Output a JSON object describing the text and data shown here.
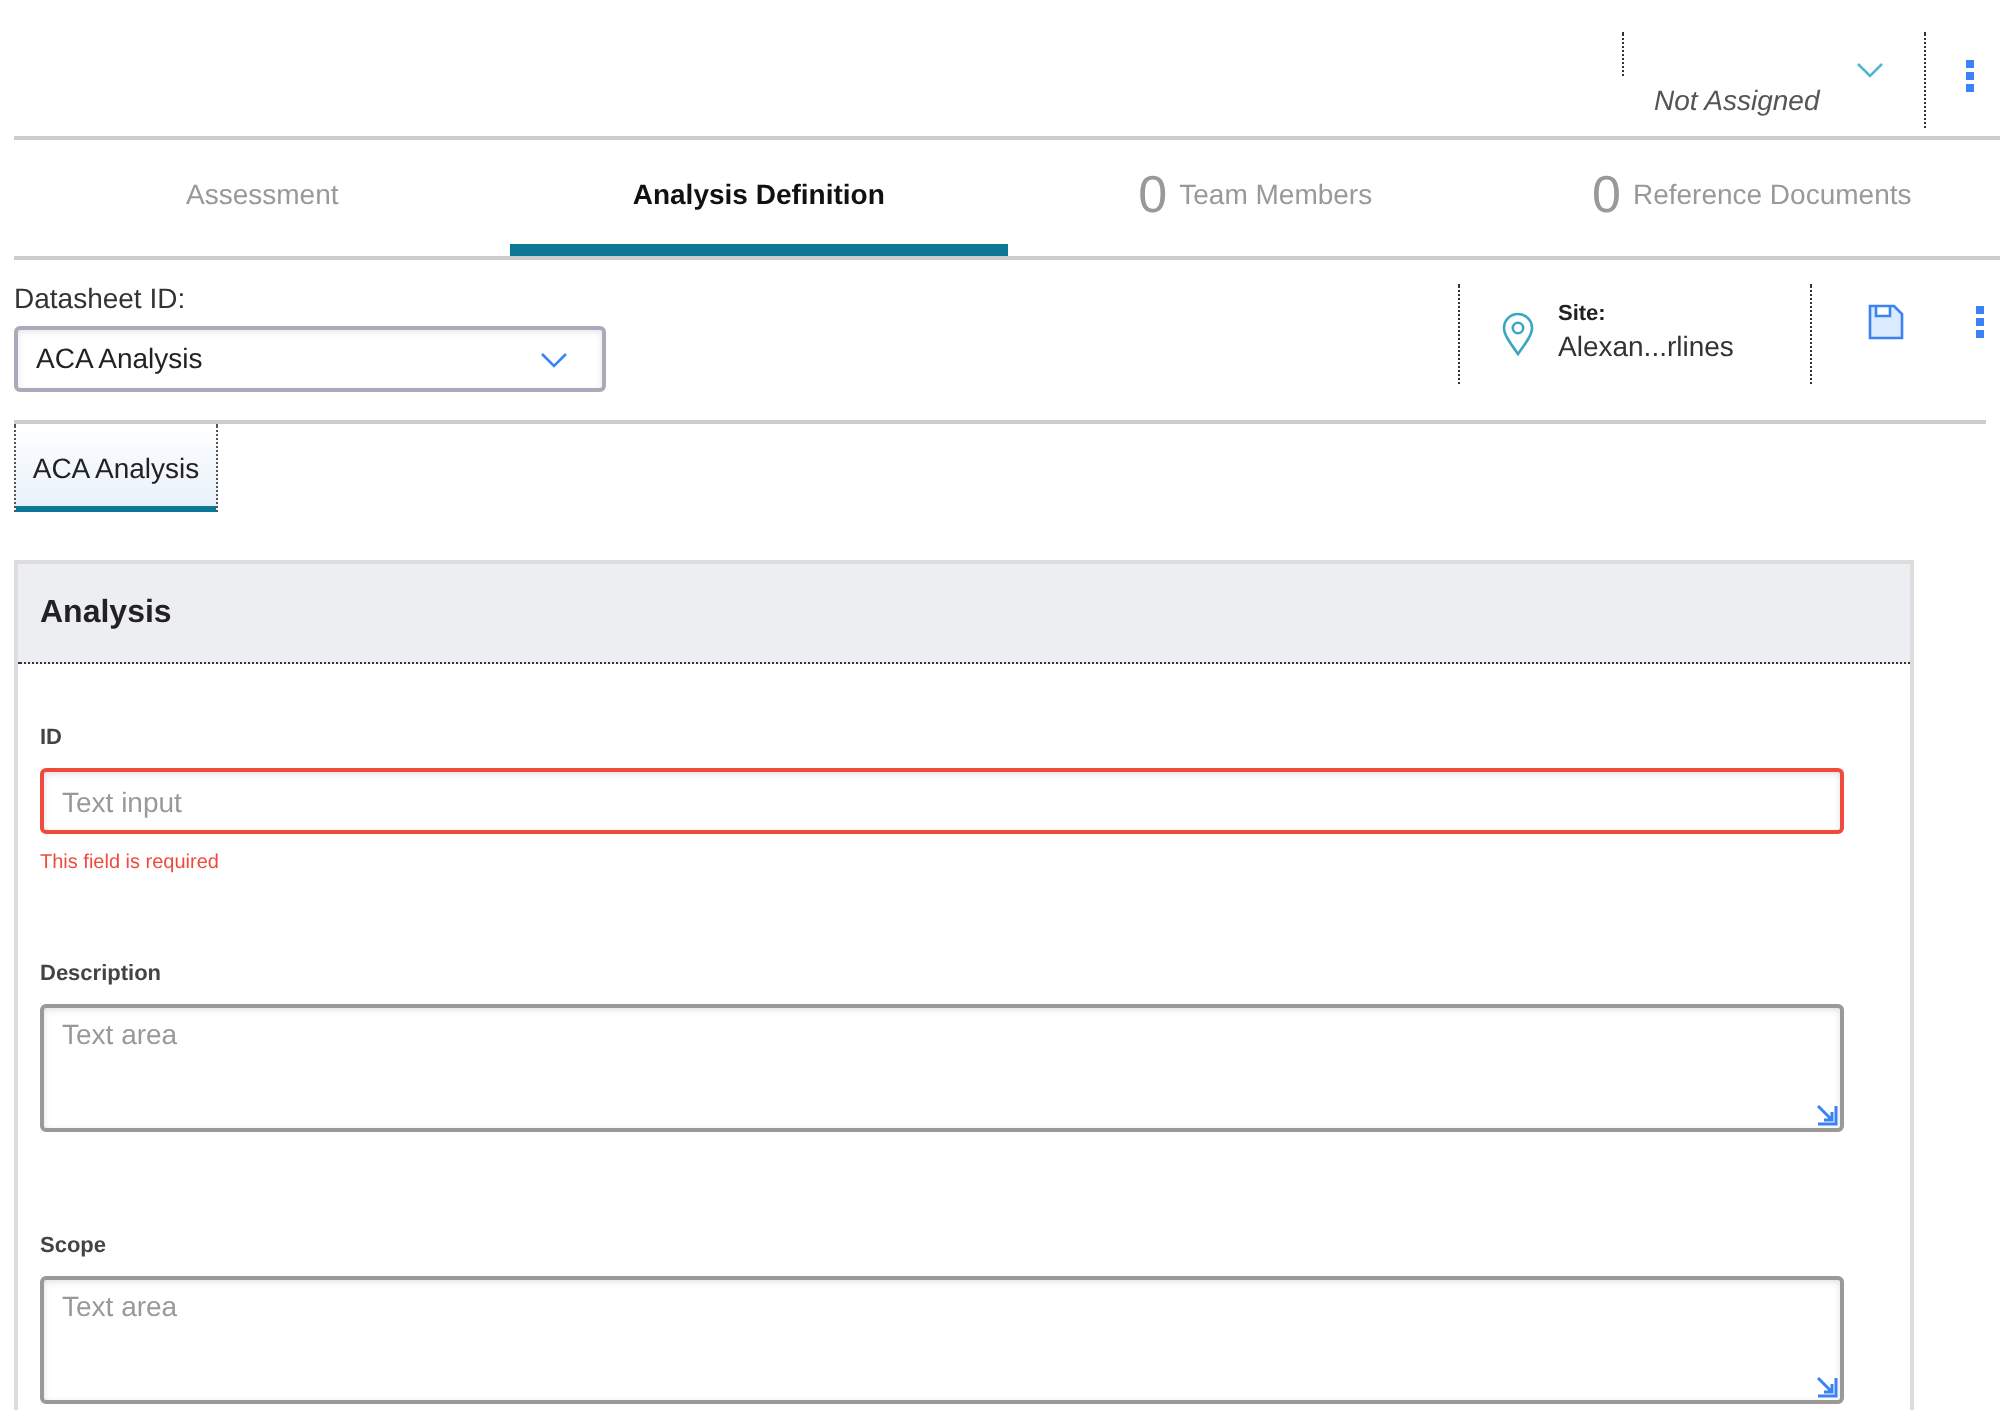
{
  "header": {
    "assignee": {
      "placeholder": "Not Assigned"
    }
  },
  "tabs": [
    {
      "label": "Assessment",
      "selected": false
    },
    {
      "label": "Analysis Definition",
      "selected": true
    },
    {
      "count": "0",
      "label": "Team Members",
      "selected": false
    },
    {
      "count": "0",
      "label": "Reference Documents",
      "selected": false
    }
  ],
  "datasheet": {
    "label": "Datasheet ID:",
    "value": "ACA Analysis"
  },
  "site": {
    "label": "Site:",
    "value": "Alexan...rlines"
  },
  "subtabs": [
    {
      "label": "ACA Analysis",
      "selected": true
    }
  ],
  "section": {
    "title": "Analysis",
    "fields": [
      {
        "kind": "input",
        "label": "ID",
        "placeholder": "Text input",
        "error": "This field is required"
      },
      {
        "kind": "textarea",
        "label": "Description",
        "placeholder": "Text area"
      },
      {
        "kind": "textarea",
        "label": "Scope",
        "placeholder": "Text area"
      }
    ]
  }
}
